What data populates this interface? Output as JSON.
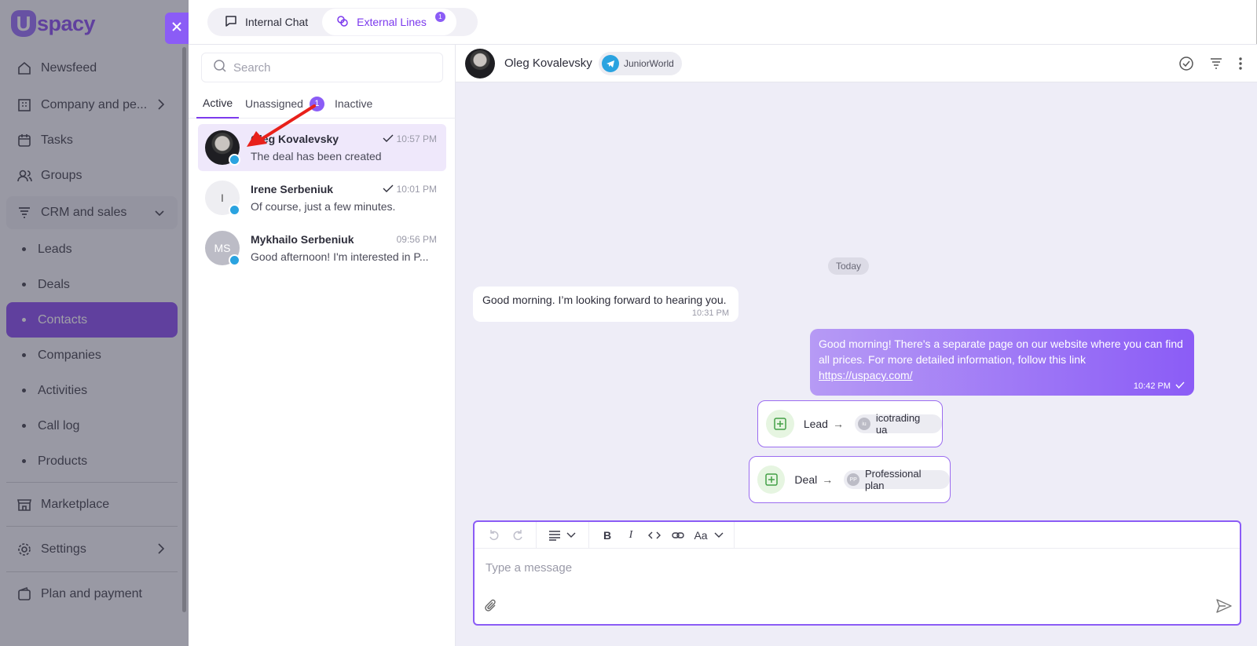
{
  "app": {
    "logo_mark": "U",
    "logo_text": "spacy"
  },
  "sidebar": {
    "items": [
      {
        "label": "Newsfeed",
        "icon": "home-icon"
      },
      {
        "label": "Company and pe...",
        "icon": "building-icon"
      },
      {
        "label": "Tasks",
        "icon": "calendar-icon"
      },
      {
        "label": "Groups",
        "icon": "users-icon"
      },
      {
        "label": "CRM and sales",
        "icon": "funnel-icon"
      },
      {
        "label": "Marketplace",
        "icon": "store-icon"
      },
      {
        "label": "Settings",
        "icon": "gear-icon"
      },
      {
        "label": "Plan and payment",
        "icon": "wallet-icon"
      }
    ],
    "crm_subitems": [
      "Leads",
      "Deals",
      "Contacts",
      "Companies",
      "Activities",
      "Call log",
      "Products"
    ],
    "active_subitem": "Contacts"
  },
  "top_tabs": {
    "internal": "Internal Chat",
    "external": "External Lines",
    "external_badge": "1"
  },
  "search": {
    "placeholder": "Search"
  },
  "sub_tabs": {
    "active": "Active",
    "unassigned": "Unassigned",
    "unassigned_count": "1",
    "inactive": "Inactive"
  },
  "conversations": [
    {
      "name": "Oleg Kovalevsky",
      "message": "The deal has been created",
      "time": "10:57 PM",
      "avatar": "",
      "selected": true
    },
    {
      "name": "Irene Serbeniuk",
      "message": "Of course, just a few minutes.",
      "time": "10:01 PM",
      "avatar": "I"
    },
    {
      "name": "Mykhailo Serbeniuk",
      "message": "Good afternoon! I'm interested in P...",
      "time": "09:56 PM",
      "avatar": "MS"
    }
  ],
  "chat": {
    "contact_name": "Oleg Kovalevsky",
    "channel_tag": "JuniorWorld",
    "day_divider": "Today",
    "incoming": {
      "text": "Good morning. I’m looking forward to hearing you.",
      "time": "10:31 PM"
    },
    "outgoing": {
      "text": "Good morning! There's a separate page on our website where you can find all prices. For more detailed information, follow this link",
      "link": "https://uspacy.com/",
      "time": "10:42 PM"
    },
    "events": [
      {
        "type": "Lead",
        "entity": "icotrading ua",
        "initials": "iu"
      },
      {
        "type": "Deal",
        "entity": "Professional plan",
        "initials": "PP"
      }
    ]
  },
  "composer": {
    "placeholder": "Type a message",
    "font_button": "Aa"
  },
  "colors": {
    "accent": "#8b5cf6",
    "telegram": "#2aa3e0"
  }
}
